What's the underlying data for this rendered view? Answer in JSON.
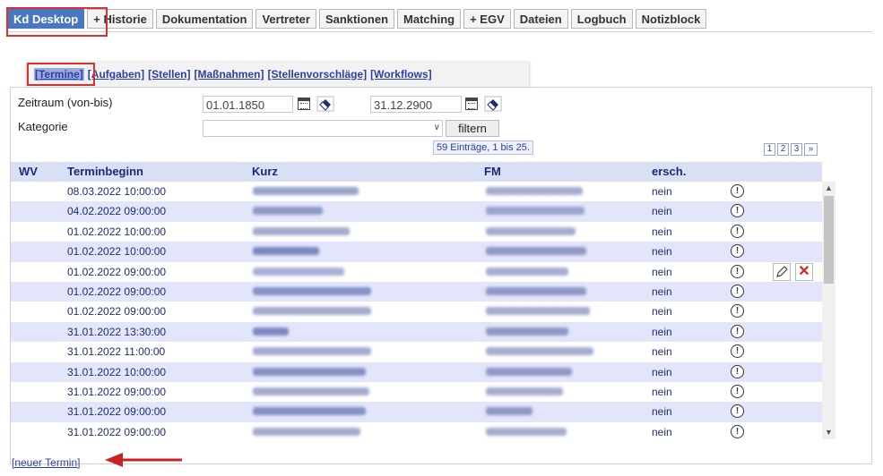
{
  "tabs": [
    {
      "label": "Kd Desktop",
      "active": true
    },
    {
      "label": "+ Historie"
    },
    {
      "label": "Dokumentation"
    },
    {
      "label": "Vertreter"
    },
    {
      "label": "Sanktionen"
    },
    {
      "label": "Matching"
    },
    {
      "label": "+ EGV"
    },
    {
      "label": "Dateien"
    },
    {
      "label": "Logbuch"
    },
    {
      "label": "Notizblock"
    }
  ],
  "subtabs": [
    "[Termine]",
    "[Aufgaben]",
    "[Stellen]",
    "[Maßnahmen]",
    "[Stellenvorschläge]",
    "[Workflows]"
  ],
  "filter": {
    "zeitraum_label": "Zeitraum (von-bis)",
    "date_from": "01.01.1850",
    "date_to": "31.12.2900",
    "kategorie_label": "Kategorie",
    "filter_button": "filtern",
    "count_text": "59 Einträge, 1 bis 25.",
    "pages": [
      "1",
      "2",
      "3",
      "»"
    ]
  },
  "table": {
    "headers": {
      "wv": "WV",
      "terminbeginn": "Terminbeginn",
      "kurz": "Kurz",
      "fm": "FM",
      "ersch": "ersch."
    },
    "rows": [
      {
        "terminbeginn": "08.03.2022 10:00:00",
        "ersch": "nein"
      },
      {
        "terminbeginn": "04.02.2022 09:00:00",
        "ersch": "nein"
      },
      {
        "terminbeginn": "01.02.2022 10:00:00",
        "ersch": "nein"
      },
      {
        "terminbeginn": "01.02.2022 10:00:00",
        "ersch": "nein"
      },
      {
        "terminbeginn": "01.02.2022 09:00:00",
        "ersch": "nein",
        "actions": true
      },
      {
        "terminbeginn": "01.02.2022 09:00:00",
        "ersch": "nein"
      },
      {
        "terminbeginn": "01.02.2022 09:00:00",
        "ersch": "nein"
      },
      {
        "terminbeginn": "31.01.2022 13:30:00",
        "ersch": "nein"
      },
      {
        "terminbeginn": "31.01.2022 11:00:00",
        "ersch": "nein"
      },
      {
        "terminbeginn": "31.01.2022 10:00:00",
        "ersch": "nein"
      },
      {
        "terminbeginn": "31.01.2022 09:00:00",
        "ersch": "nein"
      },
      {
        "terminbeginn": "31.01.2022 09:00:00",
        "ersch": "nein"
      },
      {
        "terminbeginn": "31.01.2022 09:00:00",
        "ersch": "nein"
      }
    ]
  },
  "new_link": "[neuer Termin]",
  "colors": {
    "accent": "#4a78c0",
    "link": "#2a3fa8",
    "highlight": "#d8322f",
    "row_alt": "#e3e6fa",
    "header_bg": "#d9dff4"
  }
}
